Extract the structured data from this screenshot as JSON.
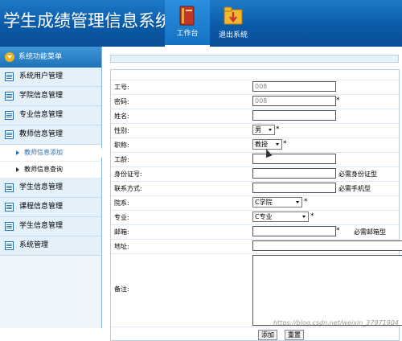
{
  "app_title": "学生成绩管理信息系统",
  "header": {
    "nav": [
      {
        "label": "工作台",
        "icon": "book-icon",
        "active": true
      },
      {
        "label": "退出系统",
        "icon": "download-folder-icon",
        "active": false
      }
    ]
  },
  "sidebar": {
    "menu_title": "系统功能菜单",
    "items": [
      {
        "label": "系统用户管理"
      },
      {
        "label": "学院信息管理"
      },
      {
        "label": "专业信息管理"
      },
      {
        "label": "教师信息管理"
      }
    ],
    "sub_items": [
      {
        "label": "教师信息添加",
        "active": true
      },
      {
        "label": "教师信息查询",
        "active": false
      }
    ],
    "items_after": [
      {
        "label": "学生信息管理"
      },
      {
        "label": "课程信息管理"
      },
      {
        "label": "学生信息管理"
      },
      {
        "label": "系统管理"
      }
    ]
  },
  "form": {
    "fields": {
      "gonghao": {
        "label": "工号",
        "value": "008"
      },
      "mima": {
        "label": "密码",
        "value": "008"
      },
      "xingming": {
        "label": "姓名",
        "value": ""
      },
      "xingbie": {
        "label": "性别",
        "value": "男"
      },
      "zhicheng": {
        "label": "职称",
        "value": "教授"
      },
      "gongling": {
        "label": "工龄",
        "value": ""
      },
      "shenfenzheng": {
        "label": "身份证号",
        "value": "",
        "hint": "必需身份证型"
      },
      "lianxi": {
        "label": "联系方式",
        "value": "",
        "hint": "必需手机型"
      },
      "yuanxi": {
        "label": "院系",
        "value": "C学院"
      },
      "zhuanye": {
        "label": "专业",
        "value": "C专业"
      },
      "youxiang": {
        "label": "邮箱",
        "value": "",
        "hint": "必需邮箱型"
      },
      "dizhi": {
        "label": "地址",
        "value": ""
      },
      "beizhu": {
        "label": "备注",
        "value": ""
      }
    },
    "buttons": {
      "add": "添加",
      "reset": "重置"
    }
  },
  "watermark": "https://blog.csdn.net/weixin_37971904"
}
